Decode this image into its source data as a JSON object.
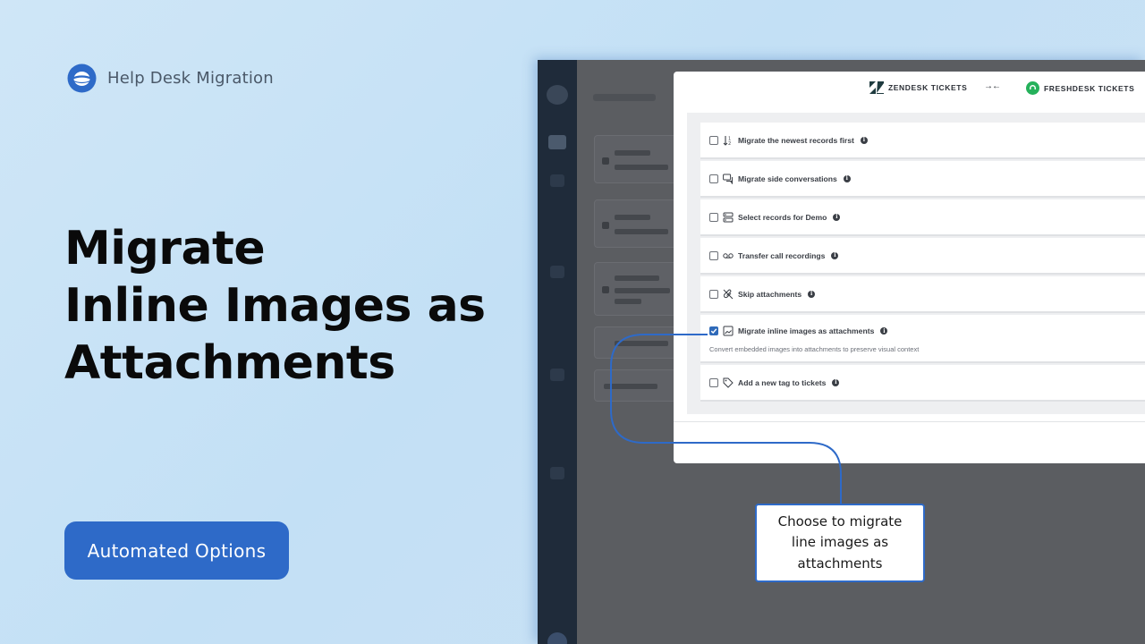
{
  "brand": {
    "name": "Help Desk Migration",
    "logo_icon": "planet-logo-icon"
  },
  "headline": {
    "line1": "Migrate",
    "line2": "Inline Images as",
    "line3": "Attachments"
  },
  "pill": {
    "label": "Automated Options"
  },
  "modal": {
    "source": {
      "label": "ZENDESK TICKETS",
      "icon": "zendesk-logo-icon"
    },
    "transfer_icon": "→←",
    "target": {
      "label": "FRESHDESK TICKETS",
      "icon": "freshdesk-logo-icon"
    },
    "options": [
      {
        "label": "Migrate the newest records first",
        "checked": false,
        "icon": "sort-order-icon"
      },
      {
        "label": "Migrate side conversations",
        "checked": false,
        "icon": "chat-bubbles-icon"
      },
      {
        "label": "Select records for Demo",
        "checked": false,
        "icon": "records-select-icon"
      },
      {
        "label": "Transfer call recordings",
        "checked": false,
        "icon": "voicemail-icon"
      },
      {
        "label": "Skip attachments",
        "checked": false,
        "icon": "paperclip-off-icon"
      },
      {
        "label": "Migrate inline images as attachments",
        "checked": true,
        "icon": "image-icon",
        "description": "Convert embedded images into attachments to preserve visual context"
      },
      {
        "label": "Add a new tag to tickets",
        "checked": false,
        "icon": "tag-icon"
      }
    ]
  },
  "callout": {
    "text": "Choose to migrate line images as attachments"
  },
  "colors": {
    "accent": "#2e6ac8",
    "freshdesk_green": "#25b15b",
    "sidebar": "#1f2b3a"
  }
}
